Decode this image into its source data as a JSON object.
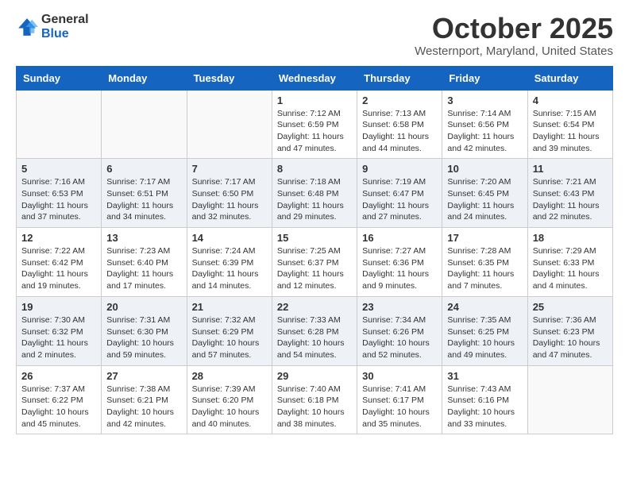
{
  "logo": {
    "general": "General",
    "blue": "Blue"
  },
  "title": "October 2025",
  "location": "Westernport, Maryland, United States",
  "days_of_week": [
    "Sunday",
    "Monday",
    "Tuesday",
    "Wednesday",
    "Thursday",
    "Friday",
    "Saturday"
  ],
  "weeks": [
    [
      {
        "day": "",
        "info": ""
      },
      {
        "day": "",
        "info": ""
      },
      {
        "day": "",
        "info": ""
      },
      {
        "day": "1",
        "info": "Sunrise: 7:12 AM\nSunset: 6:59 PM\nDaylight: 11 hours and 47 minutes."
      },
      {
        "day": "2",
        "info": "Sunrise: 7:13 AM\nSunset: 6:58 PM\nDaylight: 11 hours and 44 minutes."
      },
      {
        "day": "3",
        "info": "Sunrise: 7:14 AM\nSunset: 6:56 PM\nDaylight: 11 hours and 42 minutes."
      },
      {
        "day": "4",
        "info": "Sunrise: 7:15 AM\nSunset: 6:54 PM\nDaylight: 11 hours and 39 minutes."
      }
    ],
    [
      {
        "day": "5",
        "info": "Sunrise: 7:16 AM\nSunset: 6:53 PM\nDaylight: 11 hours and 37 minutes."
      },
      {
        "day": "6",
        "info": "Sunrise: 7:17 AM\nSunset: 6:51 PM\nDaylight: 11 hours and 34 minutes."
      },
      {
        "day": "7",
        "info": "Sunrise: 7:17 AM\nSunset: 6:50 PM\nDaylight: 11 hours and 32 minutes."
      },
      {
        "day": "8",
        "info": "Sunrise: 7:18 AM\nSunset: 6:48 PM\nDaylight: 11 hours and 29 minutes."
      },
      {
        "day": "9",
        "info": "Sunrise: 7:19 AM\nSunset: 6:47 PM\nDaylight: 11 hours and 27 minutes."
      },
      {
        "day": "10",
        "info": "Sunrise: 7:20 AM\nSunset: 6:45 PM\nDaylight: 11 hours and 24 minutes."
      },
      {
        "day": "11",
        "info": "Sunrise: 7:21 AM\nSunset: 6:43 PM\nDaylight: 11 hours and 22 minutes."
      }
    ],
    [
      {
        "day": "12",
        "info": "Sunrise: 7:22 AM\nSunset: 6:42 PM\nDaylight: 11 hours and 19 minutes."
      },
      {
        "day": "13",
        "info": "Sunrise: 7:23 AM\nSunset: 6:40 PM\nDaylight: 11 hours and 17 minutes."
      },
      {
        "day": "14",
        "info": "Sunrise: 7:24 AM\nSunset: 6:39 PM\nDaylight: 11 hours and 14 minutes."
      },
      {
        "day": "15",
        "info": "Sunrise: 7:25 AM\nSunset: 6:37 PM\nDaylight: 11 hours and 12 minutes."
      },
      {
        "day": "16",
        "info": "Sunrise: 7:27 AM\nSunset: 6:36 PM\nDaylight: 11 hours and 9 minutes."
      },
      {
        "day": "17",
        "info": "Sunrise: 7:28 AM\nSunset: 6:35 PM\nDaylight: 11 hours and 7 minutes."
      },
      {
        "day": "18",
        "info": "Sunrise: 7:29 AM\nSunset: 6:33 PM\nDaylight: 11 hours and 4 minutes."
      }
    ],
    [
      {
        "day": "19",
        "info": "Sunrise: 7:30 AM\nSunset: 6:32 PM\nDaylight: 11 hours and 2 minutes."
      },
      {
        "day": "20",
        "info": "Sunrise: 7:31 AM\nSunset: 6:30 PM\nDaylight: 10 hours and 59 minutes."
      },
      {
        "day": "21",
        "info": "Sunrise: 7:32 AM\nSunset: 6:29 PM\nDaylight: 10 hours and 57 minutes."
      },
      {
        "day": "22",
        "info": "Sunrise: 7:33 AM\nSunset: 6:28 PM\nDaylight: 10 hours and 54 minutes."
      },
      {
        "day": "23",
        "info": "Sunrise: 7:34 AM\nSunset: 6:26 PM\nDaylight: 10 hours and 52 minutes."
      },
      {
        "day": "24",
        "info": "Sunrise: 7:35 AM\nSunset: 6:25 PM\nDaylight: 10 hours and 49 minutes."
      },
      {
        "day": "25",
        "info": "Sunrise: 7:36 AM\nSunset: 6:23 PM\nDaylight: 10 hours and 47 minutes."
      }
    ],
    [
      {
        "day": "26",
        "info": "Sunrise: 7:37 AM\nSunset: 6:22 PM\nDaylight: 10 hours and 45 minutes."
      },
      {
        "day": "27",
        "info": "Sunrise: 7:38 AM\nSunset: 6:21 PM\nDaylight: 10 hours and 42 minutes."
      },
      {
        "day": "28",
        "info": "Sunrise: 7:39 AM\nSunset: 6:20 PM\nDaylight: 10 hours and 40 minutes."
      },
      {
        "day": "29",
        "info": "Sunrise: 7:40 AM\nSunset: 6:18 PM\nDaylight: 10 hours and 38 minutes."
      },
      {
        "day": "30",
        "info": "Sunrise: 7:41 AM\nSunset: 6:17 PM\nDaylight: 10 hours and 35 minutes."
      },
      {
        "day": "31",
        "info": "Sunrise: 7:43 AM\nSunset: 6:16 PM\nDaylight: 10 hours and 33 minutes."
      },
      {
        "day": "",
        "info": ""
      }
    ]
  ],
  "colors": {
    "header_bg": "#1565c0",
    "alt_row_bg": "#eef2f7"
  }
}
